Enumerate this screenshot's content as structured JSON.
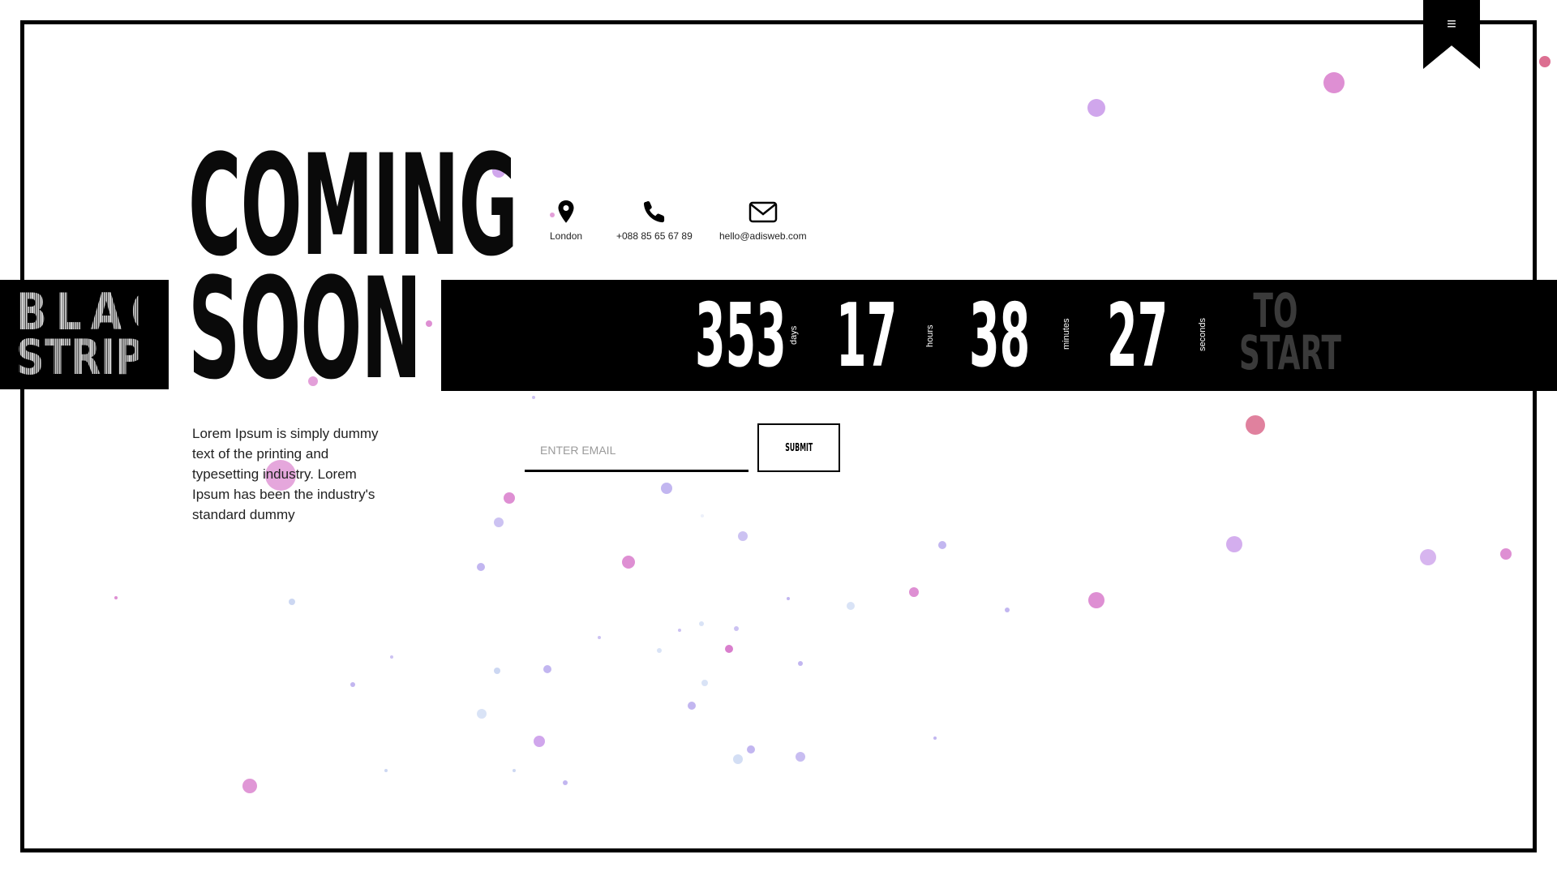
{
  "menu": {
    "icon": "hamburger-menu-icon",
    "glyph": "≡"
  },
  "logo": {
    "line1": "BLACK",
    "line2": "STRIPES"
  },
  "hero": {
    "title_line1": "COMING",
    "title_line2": "SOON"
  },
  "contacts": [
    {
      "icon": "location-pin-icon",
      "label": "London"
    },
    {
      "icon": "phone-icon",
      "label": "+088 85 65 67 89"
    },
    {
      "icon": "envelope-icon",
      "label": "hello@adisweb.com"
    }
  ],
  "countdown": {
    "days": "353",
    "days_label": "days",
    "hours": "17",
    "hours_label": "hours",
    "minutes": "38",
    "minutes_label": "minutes",
    "seconds": "27",
    "seconds_label": "seconds",
    "suffix_line1": "TO",
    "suffix_line2": "START"
  },
  "description": "Lorem Ipsum is simply dummy text of the printing and typesetting industry. Lorem Ipsum has been the industry's standard dummy",
  "subscribe": {
    "placeholder": "ENTER EMAIL",
    "button_label": "SUBMIT"
  },
  "colors": {
    "stripe": "#000000",
    "particle_pink": "#d05fc0",
    "particle_violet": "#b28ae6",
    "particle_red": "#d34b75"
  }
}
